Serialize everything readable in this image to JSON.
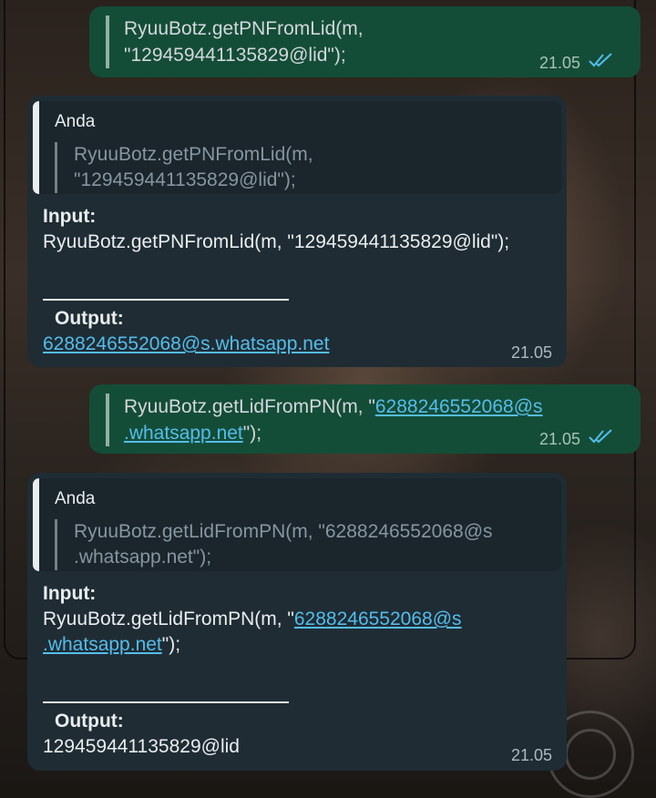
{
  "chat": {
    "messages": [
      {
        "direction": "outgoing",
        "text_line1": "RyuuBotz.getPNFromLid(m,",
        "text_line2": "\"129459441135829@lid\");",
        "time": "21.05",
        "status_icon": "double-check-read"
      },
      {
        "direction": "incoming",
        "quote_author": "Anda",
        "quote_line1": "RyuuBotz.getPNFromLid(m,",
        "quote_line2": "\"129459441135829@lid\");",
        "input_label": "Input:",
        "input_line1": "RyuuBotz.getPNFromLid(m, \"129459441135829@lid\");",
        "output_label": "Output:",
        "output_value": "6288246552068@s.whatsapp.net",
        "time": "21.05"
      },
      {
        "direction": "outgoing",
        "text_line1_prefix": "RyuuBotz.getLidFromPN(m, \"",
        "text_line1_link": "6288246552068@s",
        "text_line2_link": ".whatsapp.net",
        "text_line2_suffix": "\");",
        "time": "21.05",
        "status_icon": "double-check-read"
      },
      {
        "direction": "incoming",
        "quote_author": "Anda",
        "quote_line1": "RyuuBotz.getLidFromPN(m, \"6288246552068@s",
        "quote_line2": ".whatsapp.net\");",
        "input_label": "Input:",
        "input_line1_prefix": "RyuuBotz.getLidFromPN(m, \"",
        "input_line1_link": "6288246552068@s",
        "input_line2_link": ".whatsapp.net",
        "input_line2_suffix": "\");",
        "output_label": "Output:",
        "output_value": "129459441135829@lid",
        "time": "21.05"
      }
    ]
  },
  "colors": {
    "outgoing_bubble": "#144d37",
    "incoming_bubble": "#1f2c34",
    "link": "#53bdeb",
    "read_ticks": "#53bdeb"
  }
}
